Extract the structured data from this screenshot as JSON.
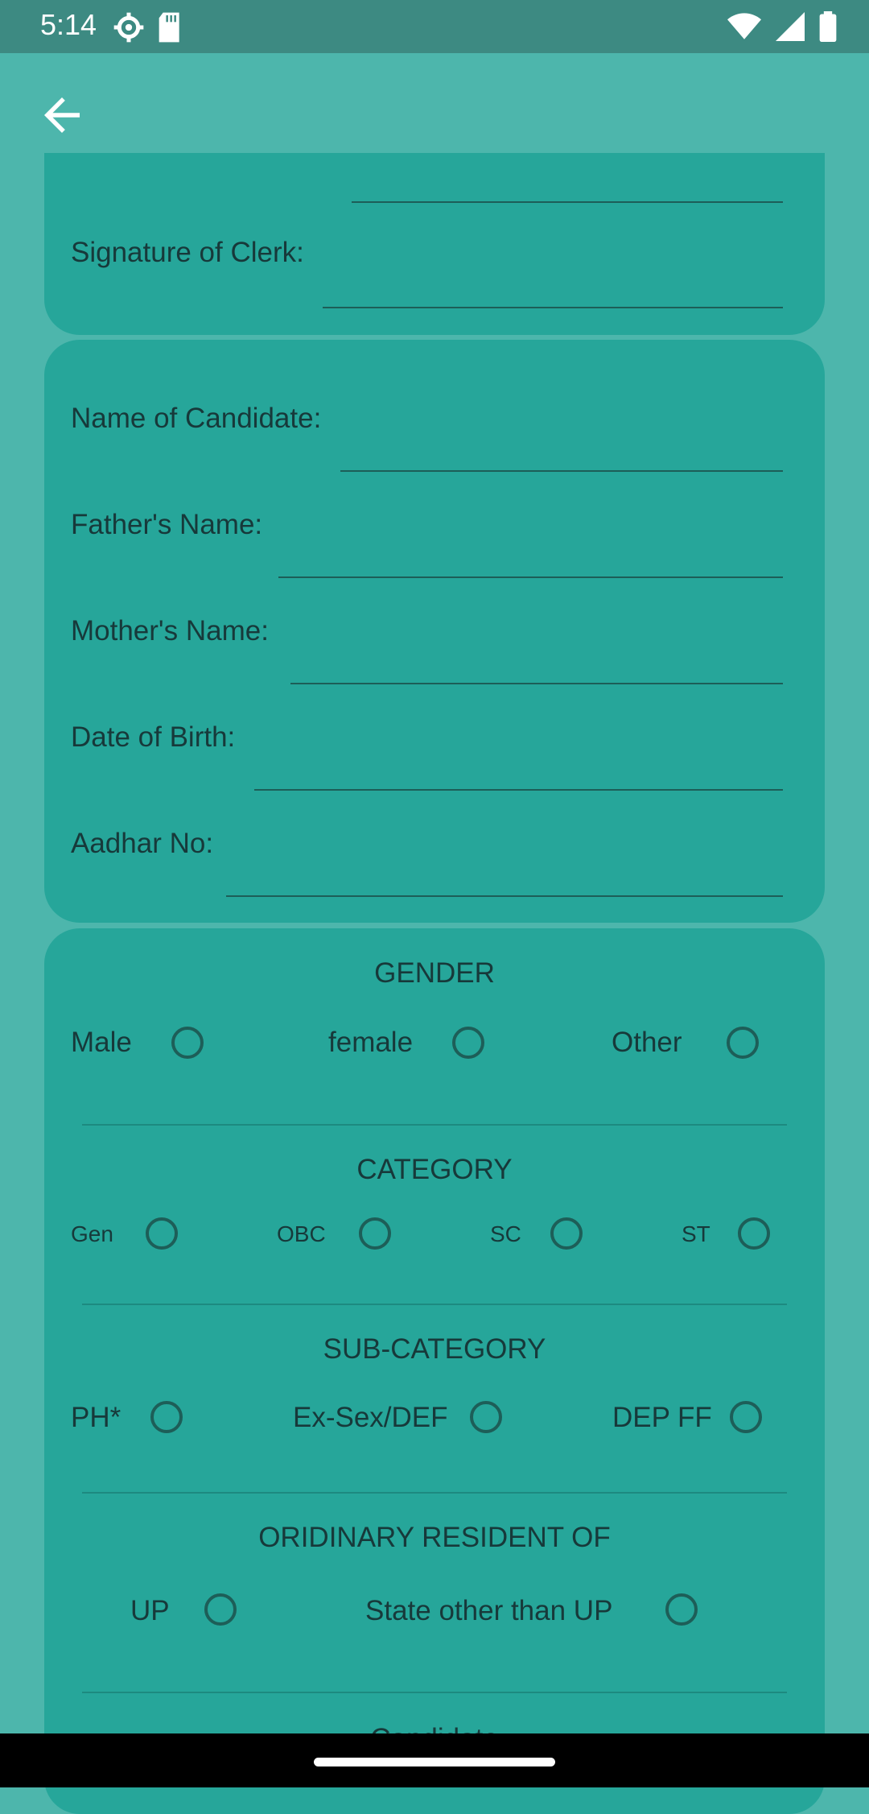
{
  "status_bar": {
    "time": "5:14"
  },
  "colors": {
    "background": "#4db6ac",
    "card": "#26a69a",
    "status_bar": "#3d8a82",
    "line": "#1d5e58"
  },
  "form": {
    "clerk_signature_label": "Signature of Clerk:",
    "candidate_fields": [
      {
        "label": "Name of Candidate:"
      },
      {
        "label": "Father's Name:"
      },
      {
        "label": "Mother's Name:"
      },
      {
        "label": "Date of Birth:"
      },
      {
        "label": "Aadhar No:"
      }
    ],
    "gender": {
      "title": "GENDER",
      "options": [
        "Male",
        "female",
        "Other"
      ]
    },
    "category": {
      "title": "CATEGORY",
      "options": [
        "Gen",
        "OBC",
        "SC",
        "ST"
      ]
    },
    "sub_category": {
      "title": "SUB-CATEGORY",
      "options": [
        "PH*",
        "Ex-Sex/DEF",
        "DEP FF"
      ]
    },
    "resident": {
      "title": "ORIDINARY RESIDENT OF",
      "options": [
        "UP",
        "State other than UP"
      ]
    },
    "next_section_partial": "Candidate"
  },
  "icons": {
    "back": "arrow-left-icon"
  }
}
